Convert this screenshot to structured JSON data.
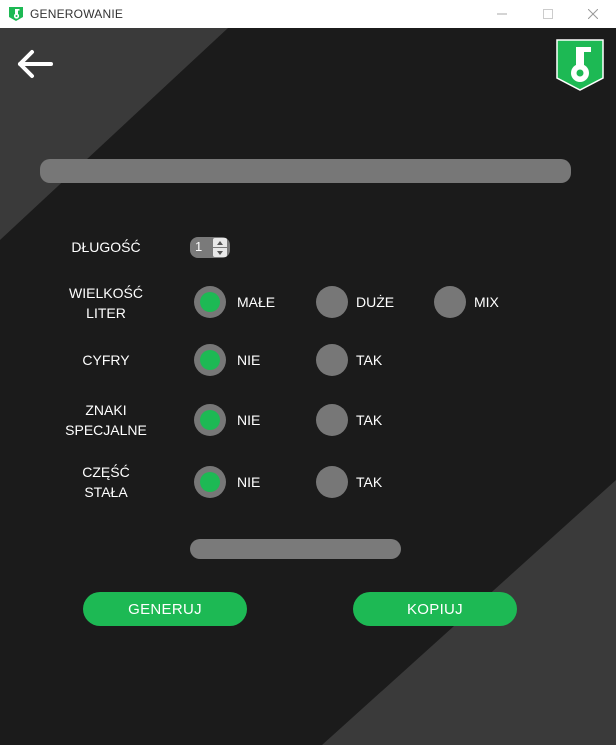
{
  "window": {
    "title": "GENEROWANIE"
  },
  "form": {
    "length_label": "DŁUGOŚĆ",
    "length_value": "1",
    "case_label_line1": "WIELKOŚĆ",
    "case_label_line2": "LITER",
    "case_options": [
      "MAŁE",
      "DUŻE",
      "MIX"
    ],
    "case_selected": "MAŁE",
    "digits_label": "CYFRY",
    "digits_options": [
      "NIE",
      "TAK"
    ],
    "digits_selected": "NIE",
    "special_label_line1": "ZNAKI",
    "special_label_line2": "SPECJALNE",
    "special_options": [
      "NIE",
      "TAK"
    ],
    "special_selected": "NIE",
    "fixed_label_line1": "CZĘŚĆ",
    "fixed_label_line2": "STAŁA",
    "fixed_options": [
      "NIE",
      "TAK"
    ],
    "fixed_selected": "NIE"
  },
  "actions": {
    "generate": "GENERUJ",
    "copy": "KOPIUJ"
  },
  "colors": {
    "accent": "#1db954",
    "control": "#777777",
    "background": "#1b1b1b",
    "panel_light": "#3a3a3a"
  },
  "icons": {
    "app": "key-shield-icon",
    "back": "arrow-left-icon"
  }
}
